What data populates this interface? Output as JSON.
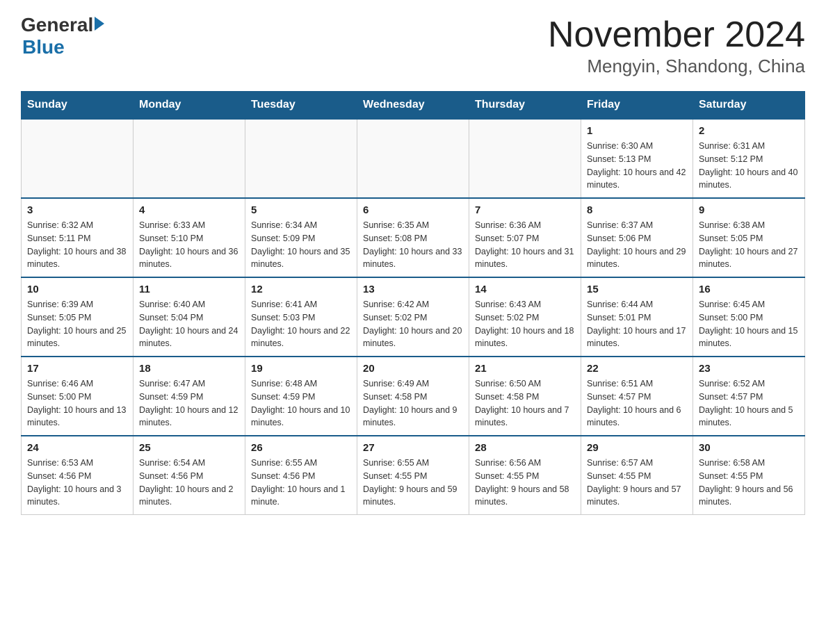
{
  "header": {
    "logo_general": "General",
    "logo_blue": "Blue",
    "month_title": "November 2024",
    "location": "Mengyin, Shandong, China"
  },
  "days_of_week": [
    "Sunday",
    "Monday",
    "Tuesday",
    "Wednesday",
    "Thursday",
    "Friday",
    "Saturday"
  ],
  "weeks": [
    [
      {
        "day": "",
        "info": ""
      },
      {
        "day": "",
        "info": ""
      },
      {
        "day": "",
        "info": ""
      },
      {
        "day": "",
        "info": ""
      },
      {
        "day": "",
        "info": ""
      },
      {
        "day": "1",
        "info": "Sunrise: 6:30 AM\nSunset: 5:13 PM\nDaylight: 10 hours and 42 minutes."
      },
      {
        "day": "2",
        "info": "Sunrise: 6:31 AM\nSunset: 5:12 PM\nDaylight: 10 hours and 40 minutes."
      }
    ],
    [
      {
        "day": "3",
        "info": "Sunrise: 6:32 AM\nSunset: 5:11 PM\nDaylight: 10 hours and 38 minutes."
      },
      {
        "day": "4",
        "info": "Sunrise: 6:33 AM\nSunset: 5:10 PM\nDaylight: 10 hours and 36 minutes."
      },
      {
        "day": "5",
        "info": "Sunrise: 6:34 AM\nSunset: 5:09 PM\nDaylight: 10 hours and 35 minutes."
      },
      {
        "day": "6",
        "info": "Sunrise: 6:35 AM\nSunset: 5:08 PM\nDaylight: 10 hours and 33 minutes."
      },
      {
        "day": "7",
        "info": "Sunrise: 6:36 AM\nSunset: 5:07 PM\nDaylight: 10 hours and 31 minutes."
      },
      {
        "day": "8",
        "info": "Sunrise: 6:37 AM\nSunset: 5:06 PM\nDaylight: 10 hours and 29 minutes."
      },
      {
        "day": "9",
        "info": "Sunrise: 6:38 AM\nSunset: 5:05 PM\nDaylight: 10 hours and 27 minutes."
      }
    ],
    [
      {
        "day": "10",
        "info": "Sunrise: 6:39 AM\nSunset: 5:05 PM\nDaylight: 10 hours and 25 minutes."
      },
      {
        "day": "11",
        "info": "Sunrise: 6:40 AM\nSunset: 5:04 PM\nDaylight: 10 hours and 24 minutes."
      },
      {
        "day": "12",
        "info": "Sunrise: 6:41 AM\nSunset: 5:03 PM\nDaylight: 10 hours and 22 minutes."
      },
      {
        "day": "13",
        "info": "Sunrise: 6:42 AM\nSunset: 5:02 PM\nDaylight: 10 hours and 20 minutes."
      },
      {
        "day": "14",
        "info": "Sunrise: 6:43 AM\nSunset: 5:02 PM\nDaylight: 10 hours and 18 minutes."
      },
      {
        "day": "15",
        "info": "Sunrise: 6:44 AM\nSunset: 5:01 PM\nDaylight: 10 hours and 17 minutes."
      },
      {
        "day": "16",
        "info": "Sunrise: 6:45 AM\nSunset: 5:00 PM\nDaylight: 10 hours and 15 minutes."
      }
    ],
    [
      {
        "day": "17",
        "info": "Sunrise: 6:46 AM\nSunset: 5:00 PM\nDaylight: 10 hours and 13 minutes."
      },
      {
        "day": "18",
        "info": "Sunrise: 6:47 AM\nSunset: 4:59 PM\nDaylight: 10 hours and 12 minutes."
      },
      {
        "day": "19",
        "info": "Sunrise: 6:48 AM\nSunset: 4:59 PM\nDaylight: 10 hours and 10 minutes."
      },
      {
        "day": "20",
        "info": "Sunrise: 6:49 AM\nSunset: 4:58 PM\nDaylight: 10 hours and 9 minutes."
      },
      {
        "day": "21",
        "info": "Sunrise: 6:50 AM\nSunset: 4:58 PM\nDaylight: 10 hours and 7 minutes."
      },
      {
        "day": "22",
        "info": "Sunrise: 6:51 AM\nSunset: 4:57 PM\nDaylight: 10 hours and 6 minutes."
      },
      {
        "day": "23",
        "info": "Sunrise: 6:52 AM\nSunset: 4:57 PM\nDaylight: 10 hours and 5 minutes."
      }
    ],
    [
      {
        "day": "24",
        "info": "Sunrise: 6:53 AM\nSunset: 4:56 PM\nDaylight: 10 hours and 3 minutes."
      },
      {
        "day": "25",
        "info": "Sunrise: 6:54 AM\nSunset: 4:56 PM\nDaylight: 10 hours and 2 minutes."
      },
      {
        "day": "26",
        "info": "Sunrise: 6:55 AM\nSunset: 4:56 PM\nDaylight: 10 hours and 1 minute."
      },
      {
        "day": "27",
        "info": "Sunrise: 6:55 AM\nSunset: 4:55 PM\nDaylight: 9 hours and 59 minutes."
      },
      {
        "day": "28",
        "info": "Sunrise: 6:56 AM\nSunset: 4:55 PM\nDaylight: 9 hours and 58 minutes."
      },
      {
        "day": "29",
        "info": "Sunrise: 6:57 AM\nSunset: 4:55 PM\nDaylight: 9 hours and 57 minutes."
      },
      {
        "day": "30",
        "info": "Sunrise: 6:58 AM\nSunset: 4:55 PM\nDaylight: 9 hours and 56 minutes."
      }
    ]
  ]
}
